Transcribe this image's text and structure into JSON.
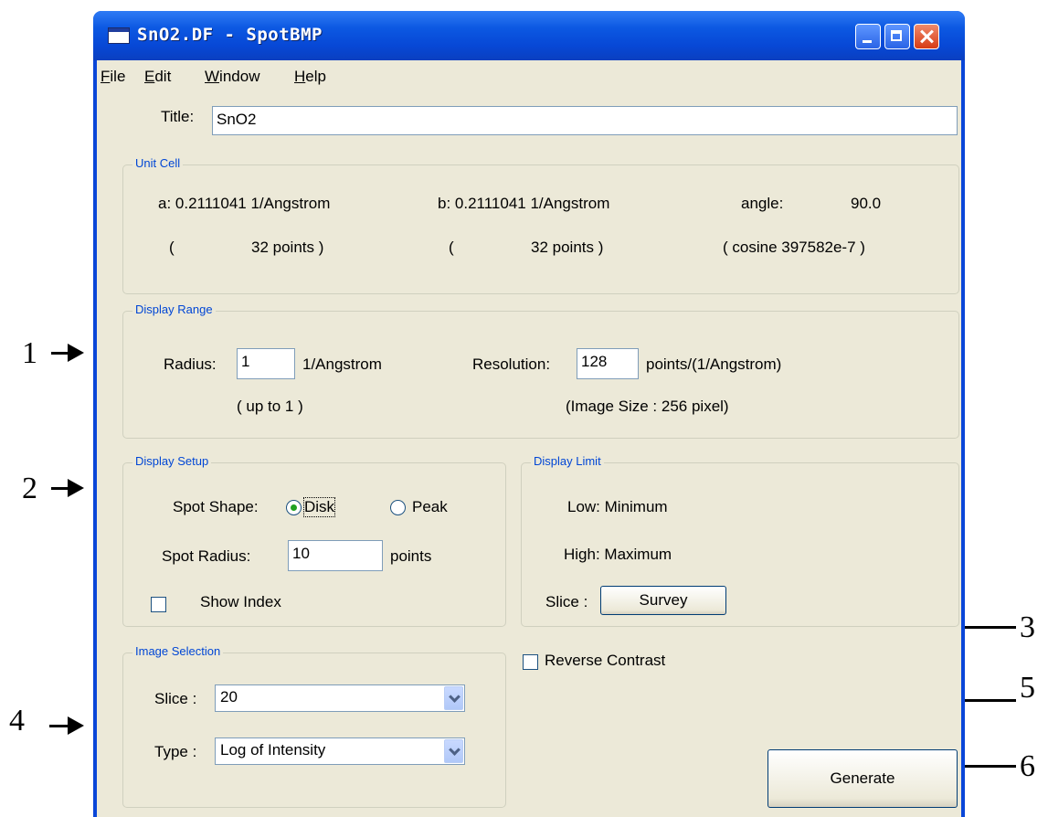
{
  "window": {
    "title": "SnO2.DF - SpotBMP"
  },
  "menu": [
    "File",
    "Edit",
    "Window",
    "Help"
  ],
  "title_field": {
    "label": "Title:",
    "value": "SnO2"
  },
  "unit_cell": {
    "group_title": "Unit Cell",
    "a_label": "a:  0.2111041 1/Angstrom",
    "b_label": "b:  0.2111041 1/Angstrom",
    "angle_label": "angle:",
    "angle_value": "90.0",
    "open_paren_a": "(",
    "a_points": "32  points )",
    "open_paren_b": "(",
    "b_points": "32  points )",
    "cosine": "( cosine 397582e-7 )"
  },
  "display_range": {
    "group_title": "Display Range",
    "radius_label": "Radius:",
    "radius_value": "1",
    "radius_unit": "1/Angstrom",
    "radius_hint": "( up to 1 )",
    "resolution_label": "Resolution:",
    "resolution_value": "128",
    "resolution_unit": "points/(1/Angstrom)",
    "image_size": "(Image Size :    256 pixel)"
  },
  "display_setup": {
    "group_title": "Display Setup",
    "spot_shape_label": "Spot Shape:",
    "option_disk": "Disk",
    "option_peak": "Peak",
    "selected_shape": "Disk",
    "spot_radius_label": "Spot Radius:",
    "spot_radius_value": "10",
    "spot_radius_unit": "points",
    "show_index_label": "Show Index",
    "show_index_checked": false
  },
  "display_limit": {
    "group_title": "Display Limit",
    "low": "Low: Minimum",
    "high": "High: Maximum",
    "slice_label": "Slice :",
    "survey_button": "Survey"
  },
  "reverse_contrast": {
    "label": "Reverse Contrast",
    "checked": false
  },
  "image_selection": {
    "group_title": "Image Selection",
    "slice_label": "Slice :",
    "slice_value": "20",
    "type_label": "Type :",
    "type_value": "Log of Intensity"
  },
  "generate_button": "Generate",
  "annotations": [
    "1",
    "2",
    "3",
    "4",
    "5",
    "6"
  ],
  "colors": {
    "titlebar": "#0c58e2",
    "client_bg": "#ece9d8",
    "group_title": "#0046d5",
    "radio_dot": "#21a121",
    "close_button": "#d63b15"
  }
}
